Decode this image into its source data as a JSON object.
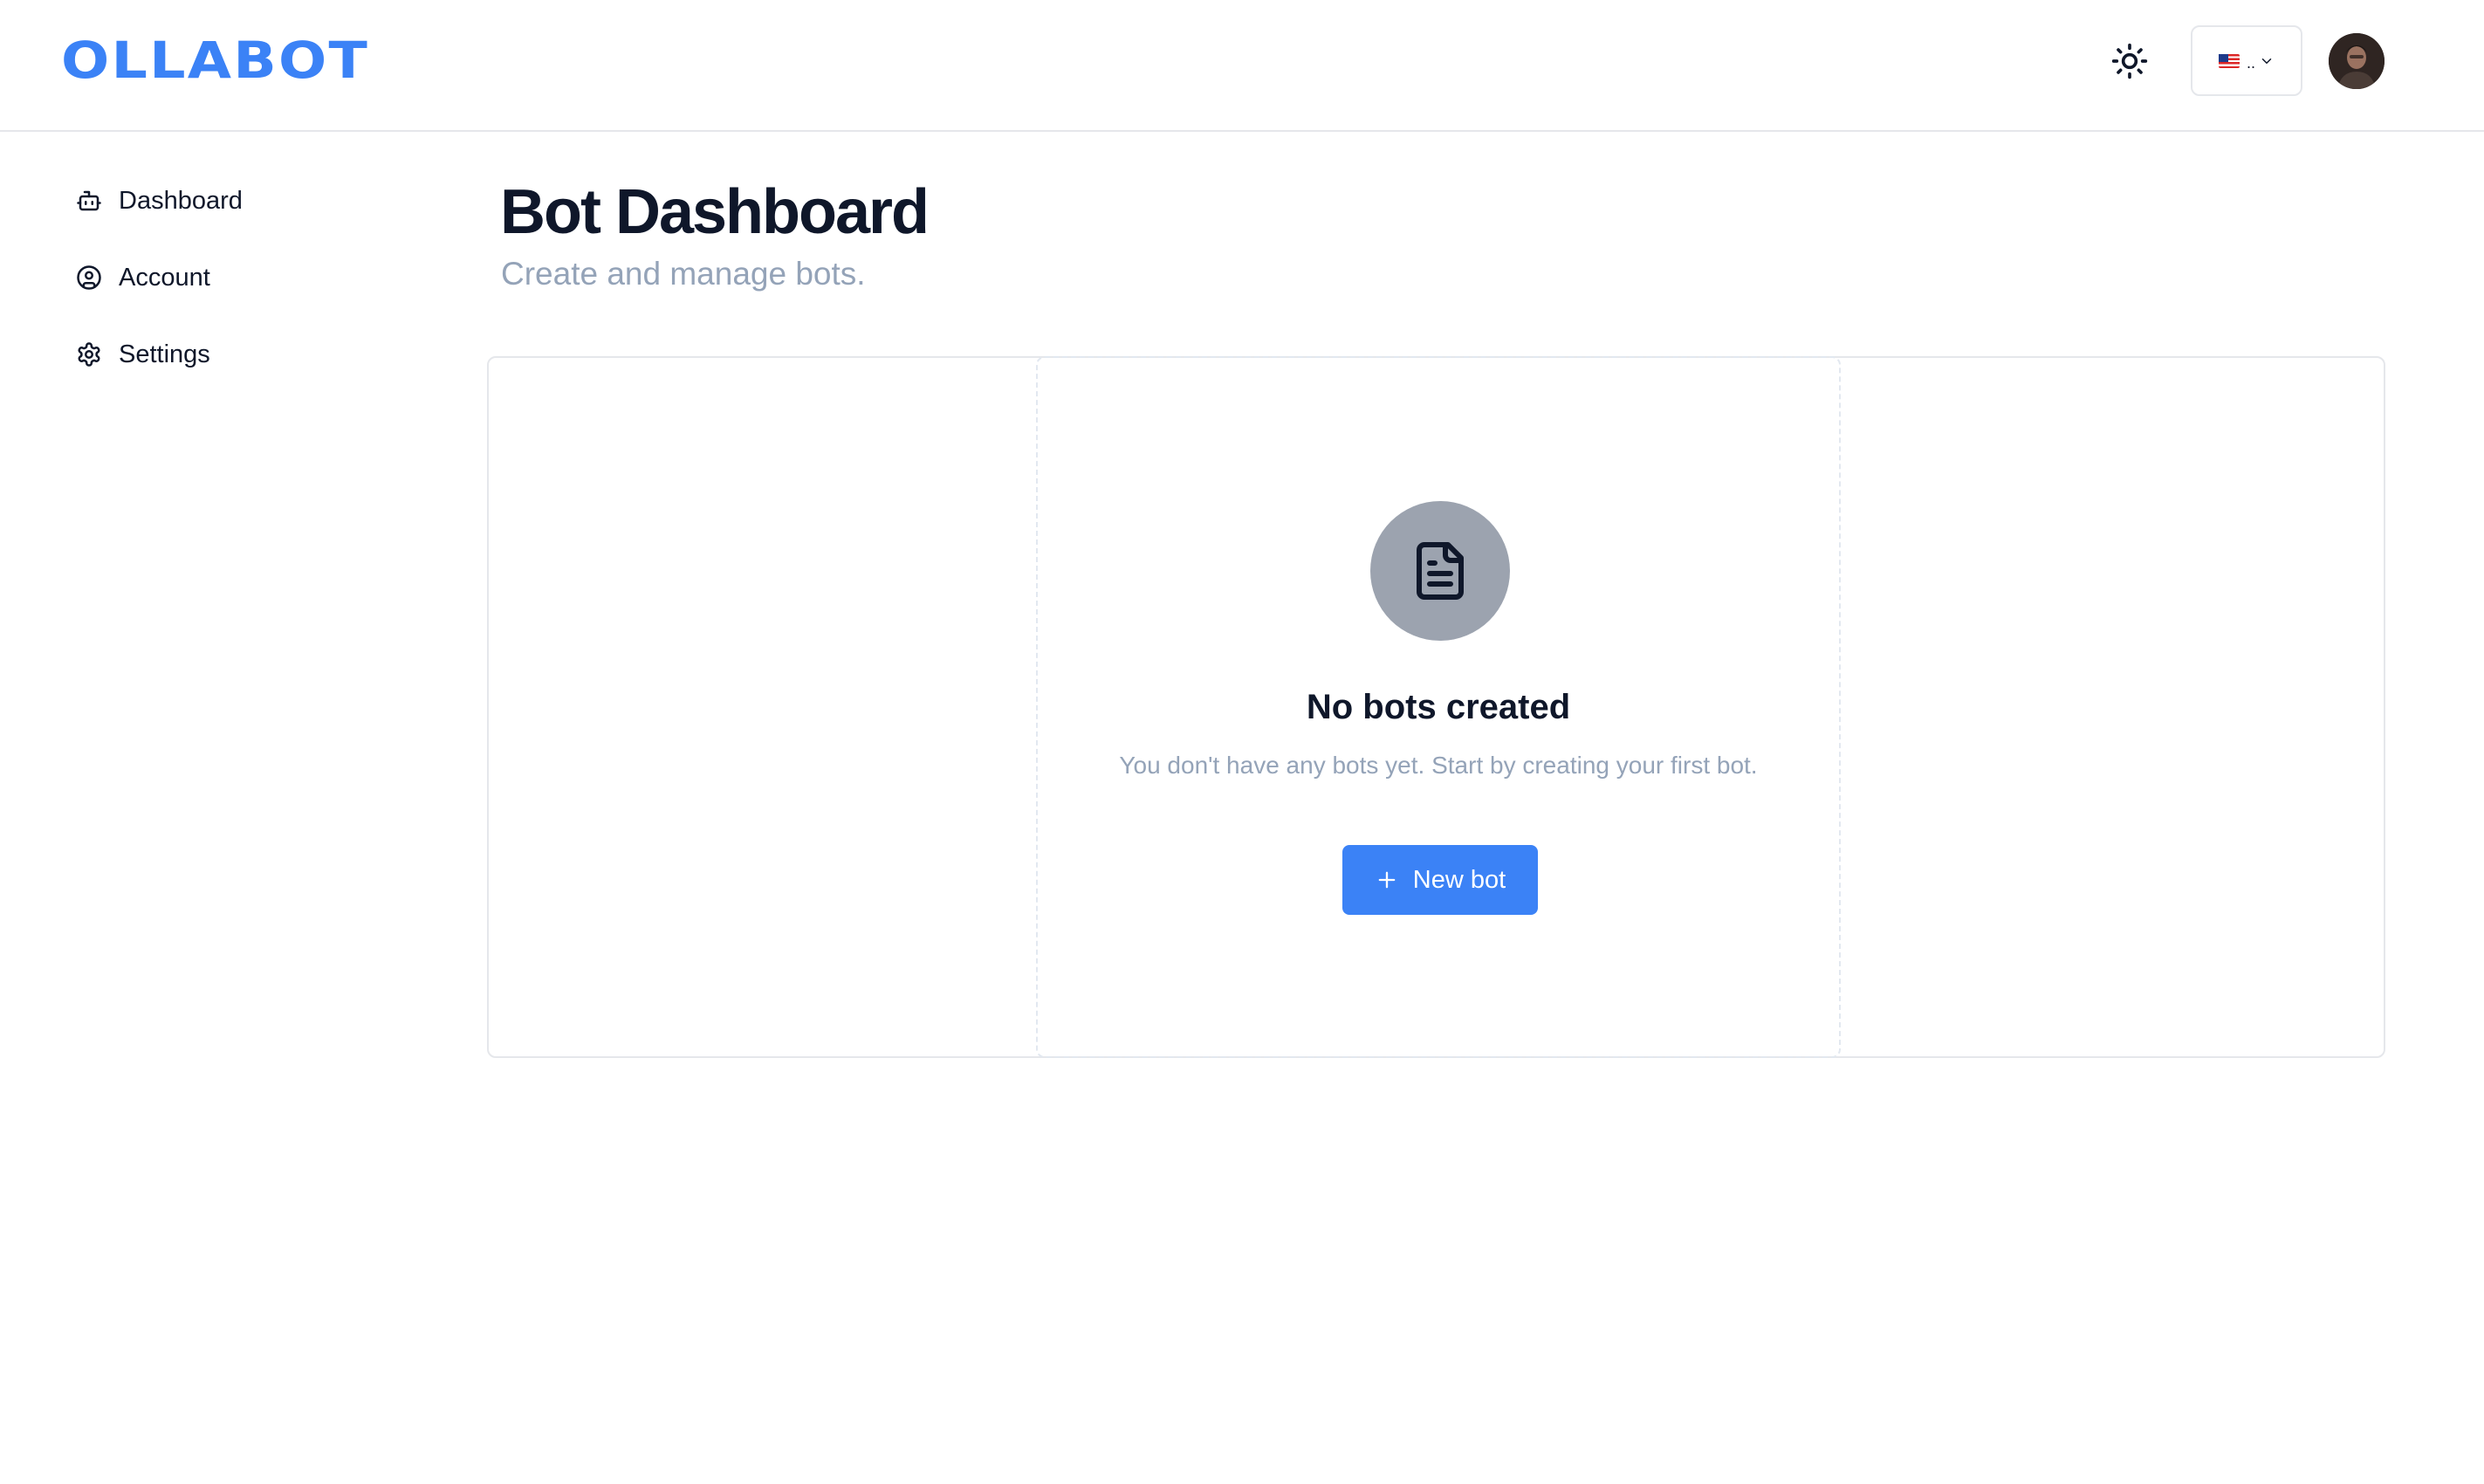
{
  "header": {
    "logo_text": "OLLABOT",
    "theme_icon": "sun-icon",
    "language": {
      "selected": "🇺🇸..",
      "icon": "chevron-down-icon"
    },
    "avatar_icon": "user-avatar"
  },
  "sidebar": {
    "items": [
      {
        "label": "Dashboard",
        "icon": "bot-icon"
      },
      {
        "label": "Account",
        "icon": "user-circle-icon"
      },
      {
        "label": "Settings",
        "icon": "gear-icon"
      }
    ]
  },
  "main": {
    "title": "Bot Dashboard",
    "subtitle": "Create and manage bots."
  },
  "empty_state": {
    "icon": "document-icon",
    "title": "No bots created",
    "description": "You don't have any bots yet. Start by creating your first bot.",
    "button_label": "New bot",
    "button_icon": "plus-icon"
  },
  "colors": {
    "accent": "#3b82f6",
    "muted_text": "#94a3b8",
    "border": "#e5e7eb"
  }
}
